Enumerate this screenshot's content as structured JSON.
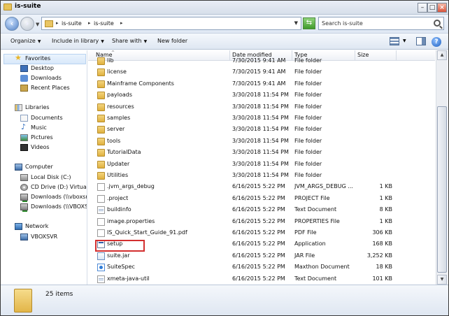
{
  "window": {
    "title": "is-suite"
  },
  "address": {
    "crumbs": [
      "is-suite",
      "is-suite"
    ]
  },
  "search": {
    "placeholder": "Search is-suite"
  },
  "toolbar": {
    "organize": "Organize",
    "include_in_library": "Include in library",
    "share_with": "Share with",
    "new_folder": "New folder"
  },
  "nav": {
    "favorites": {
      "label": "Favorites",
      "items": [
        "Desktop",
        "Downloads",
        "Recent Places"
      ]
    },
    "libraries": {
      "label": "Libraries",
      "items": [
        "Documents",
        "Music",
        "Pictures",
        "Videos"
      ]
    },
    "computer": {
      "label": "Computer",
      "items": [
        "Local Disk (C:)",
        "CD Drive (D:) VirtualBo",
        "Downloads (\\\\vboxsrv",
        "Downloads (\\\\VBOXSVR"
      ]
    },
    "network": {
      "label": "Network",
      "items": [
        "VBOXSVR"
      ]
    }
  },
  "columns": {
    "name": "Name",
    "date": "Date modified",
    "type": "Type",
    "size": "Size"
  },
  "files": [
    {
      "name": "lib",
      "date": "7/30/2015 9:41 AM",
      "type": "File folder",
      "size": "",
      "icon": "folder"
    },
    {
      "name": "license",
      "date": "7/30/2015 9:41 AM",
      "type": "File folder",
      "size": "",
      "icon": "folder"
    },
    {
      "name": "Mainframe Components",
      "date": "7/30/2015 9:41 AM",
      "type": "File folder",
      "size": "",
      "icon": "folder"
    },
    {
      "name": "payloads",
      "date": "3/30/2018 11:54 PM",
      "type": "File folder",
      "size": "",
      "icon": "folder"
    },
    {
      "name": "resources",
      "date": "3/30/2018 11:54 PM",
      "type": "File folder",
      "size": "",
      "icon": "folder"
    },
    {
      "name": "samples",
      "date": "3/30/2018 11:54 PM",
      "type": "File folder",
      "size": "",
      "icon": "folder"
    },
    {
      "name": "server",
      "date": "3/30/2018 11:54 PM",
      "type": "File folder",
      "size": "",
      "icon": "folder"
    },
    {
      "name": "tools",
      "date": "3/30/2018 11:54 PM",
      "type": "File folder",
      "size": "",
      "icon": "folder"
    },
    {
      "name": "TutorialData",
      "date": "3/30/2018 11:54 PM",
      "type": "File folder",
      "size": "",
      "icon": "folder"
    },
    {
      "name": "Updater",
      "date": "3/30/2018 11:54 PM",
      "type": "File folder",
      "size": "",
      "icon": "folder"
    },
    {
      "name": "Utilities",
      "date": "3/30/2018 11:54 PM",
      "type": "File folder",
      "size": "",
      "icon": "folder"
    },
    {
      "name": ".jvm_args_debug",
      "date": "6/16/2015 5:22 PM",
      "type": "JVM_ARGS_DEBUG ...",
      "size": "1 KB",
      "icon": "file"
    },
    {
      "name": ".project",
      "date": "6/16/2015 5:22 PM",
      "type": "PROJECT File",
      "size": "1 KB",
      "icon": "file"
    },
    {
      "name": "buildinfo",
      "date": "6/16/2015 5:22 PM",
      "type": "Text Document",
      "size": "8 KB",
      "icon": "txt"
    },
    {
      "name": "image.properties",
      "date": "6/16/2015 5:22 PM",
      "type": "PROPERTIES File",
      "size": "1 KB",
      "icon": "file"
    },
    {
      "name": "IS_Quick_Start_Guide_91.pdf",
      "date": "6/16/2015 5:22 PM",
      "type": "PDF File",
      "size": "306 KB",
      "icon": "pdf"
    },
    {
      "name": "setup",
      "date": "6/16/2015 5:22 PM",
      "type": "Application",
      "size": "168 KB",
      "icon": "app"
    },
    {
      "name": "suite.jar",
      "date": "6/16/2015 5:22 PM",
      "type": "JAR File",
      "size": "3,252 KB",
      "icon": "jar"
    },
    {
      "name": "SuiteSpec",
      "date": "6/16/2015 5:22 PM",
      "type": "Maxthon Document",
      "size": "18 KB",
      "icon": "mx"
    },
    {
      "name": "xmeta-java-util",
      "date": "6/16/2015 5:22 PM",
      "type": "Text Document",
      "size": "101 KB",
      "icon": "txt"
    }
  ],
  "status": {
    "count": "25 items"
  },
  "colors": {
    "highlight": "#d32f2f",
    "accent": "#2f5fa8"
  }
}
